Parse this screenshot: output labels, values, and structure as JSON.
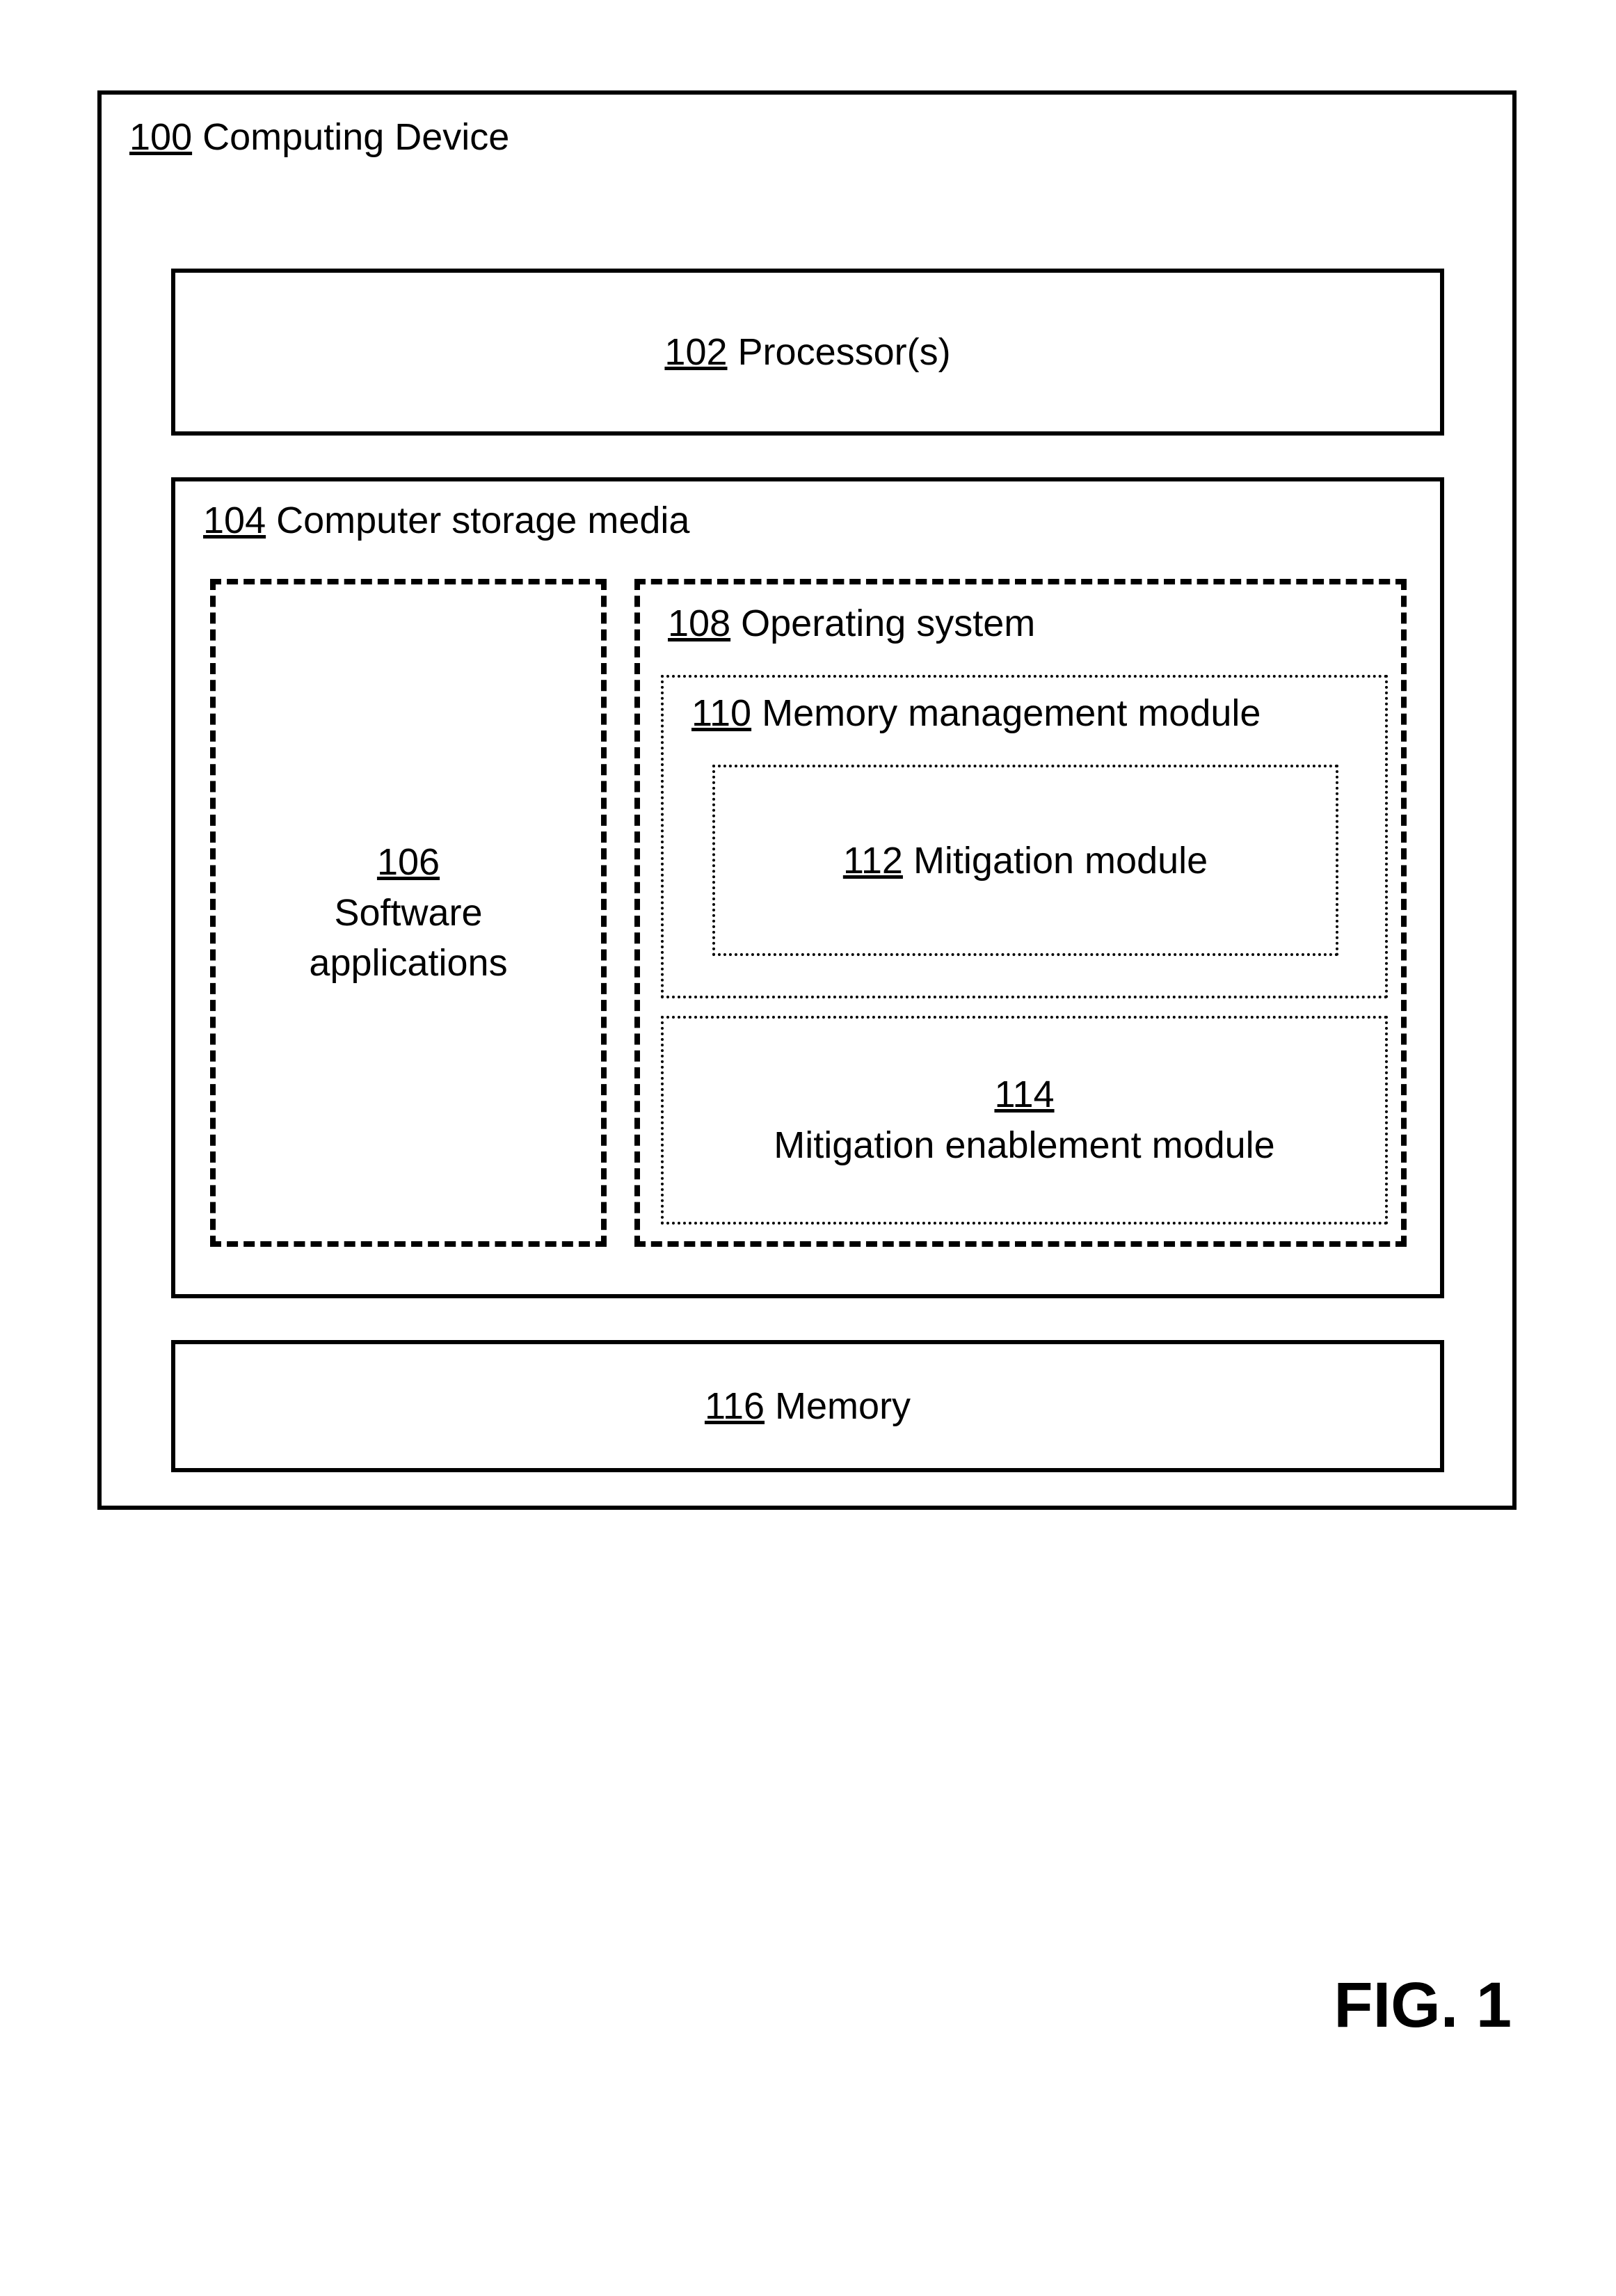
{
  "figure_caption": "FIG. 1",
  "device": {
    "ref": "100",
    "label": "Computing Device"
  },
  "processor": {
    "ref": "102",
    "label": "Processor(s)"
  },
  "storage": {
    "ref": "104",
    "label": "Computer storage media"
  },
  "apps": {
    "ref": "106",
    "label1": "Software",
    "label2": "applications"
  },
  "os": {
    "ref": "108",
    "label": "Operating system"
  },
  "mmm": {
    "ref": "110",
    "label": "Memory management module"
  },
  "mitigation": {
    "ref": "112",
    "label": "Mitigation module"
  },
  "mit_enable": {
    "ref": "114",
    "label": "Mitigation enablement module"
  },
  "memory": {
    "ref": "116",
    "label": "Memory"
  }
}
